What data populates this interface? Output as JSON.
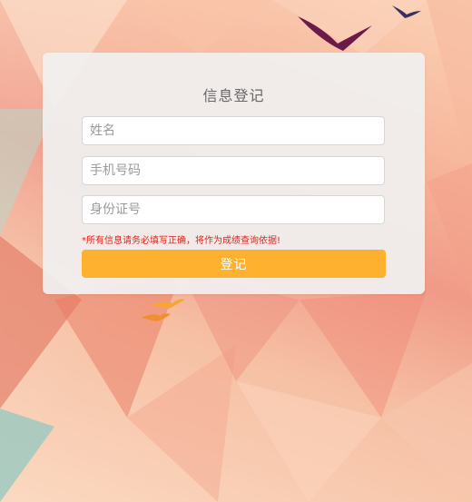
{
  "form": {
    "title": "信息登记",
    "name_placeholder": "姓名",
    "phone_placeholder": "手机号码",
    "id_placeholder": "身份证号",
    "notice": "*所有信息请务必填写正确，将作为成绩查询依据!",
    "submit_label": "登记"
  },
  "colors": {
    "button": "#fdb12f",
    "notice": "#e1241d",
    "background_warm": "#f09a87"
  }
}
